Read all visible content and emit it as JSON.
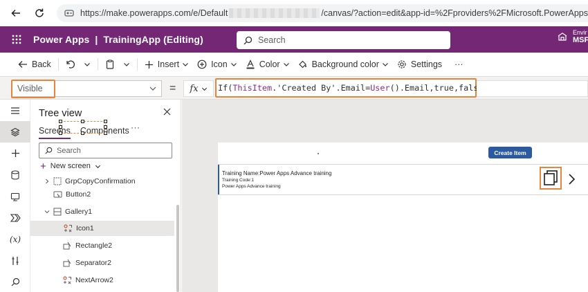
{
  "browser": {
    "url_prefix": "https://make.powerapps.com/e/Default",
    "url_suffix": "/canvas/?action=edit&app-id=%2Fproviders%2FMicrosoft.PowerApps"
  },
  "header": {
    "product": "Power Apps",
    "separator": "|",
    "app_name": "TrainingApp (Editing)",
    "search_placeholder": "Search",
    "env_label": "Envir",
    "env_org": "MSF",
    "color": "#742774"
  },
  "command_bar": {
    "back": "Back",
    "insert": "Insert",
    "icon": "Icon",
    "color": "Color",
    "background_color": "Background color",
    "settings": "Settings",
    "more": "···"
  },
  "formula_bar": {
    "property": "Visible",
    "equals": "=",
    "fx": "fx",
    "formula": {
      "if": "If(",
      "thisitem": "ThisItem",
      "mid": ".'Created By'.Email=",
      "user": "User",
      "end": "().Email,true,false)"
    },
    "highlight_color": "#e8853a"
  },
  "tree_view": {
    "title": "Tree view",
    "tabs": [
      "Screens",
      "Components"
    ],
    "search_placeholder": "Search",
    "new_screen": "New screen",
    "nodes": [
      {
        "label": "GrpCopyConfirmation"
      },
      {
        "label": "Button2"
      },
      {
        "label": "Gallery1"
      },
      {
        "label": "Icon1"
      },
      {
        "label": "Rectangle2"
      },
      {
        "label": "Separator2"
      },
      {
        "label": "NextArrow2"
      }
    ],
    "more": "···"
  },
  "canvas": {
    "create_button": "Create Item",
    "gallery_item": {
      "title": "Training Name:Power Apps Advance training",
      "code": "Training Code:1",
      "subtitle": "Power Apps Advance training"
    },
    "button_color": "#2c5aa0"
  }
}
